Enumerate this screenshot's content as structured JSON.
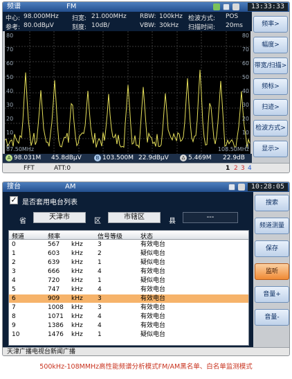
{
  "analyzer": {
    "title": "频谱",
    "mode": "FM",
    "time": "13:33:33",
    "info": {
      "center_label": "中心:",
      "center_value": "98.000MHz",
      "span_label": "扫宽:",
      "span_value": "21.000MHz",
      "rbw_label": "RBW:",
      "rbw_value": "100kHz",
      "detector_label": "检波方式:",
      "detector_value": "POS",
      "ref_label": "参考:",
      "ref_value": "80.0dBμV",
      "scale_label": "刻度:",
      "scale_value": "10dB/",
      "vbw_label": "VBW:",
      "vbw_value": "30kHz",
      "sweep_label": "扫描时间:",
      "sweep_value": "20ms"
    },
    "level_labels": [
      "80",
      "70",
      "60",
      "50",
      "40",
      "30",
      "20",
      "10",
      "0"
    ],
    "freq_start": "87.50MHz",
    "freq_stop": "108.50MHz",
    "markers": [
      {
        "id": "A",
        "freq": "98.031M",
        "level": "45.8dBμV"
      },
      {
        "id": "B",
        "freq": "103.500M",
        "level": "22.9dBμV"
      },
      {
        "id": "Δ",
        "freq": "5.469M",
        "level": "22.9dB"
      }
    ],
    "status": {
      "fft": "FFT",
      "att": "ATT:0",
      "pages": [
        "1",
        "2",
        "3",
        "4"
      ]
    },
    "softkeys": [
      "频率>",
      "幅度>",
      "带宽/扫描>",
      "频标>",
      "扫迹>",
      "检波方式>",
      "显示>"
    ],
    "colors": {
      "trace": "#e6e05a",
      "marker_a": "#bfe08a",
      "marker_b": "#a9c8ea",
      "active": "#f08a35"
    }
  },
  "receiver": {
    "title": "搜台",
    "mode": "AM",
    "time": "10:28:05",
    "use_station_list": {
      "label": "是否套用电台列表",
      "checked": "✓"
    },
    "location": {
      "province_label": "省",
      "province_value": "天津市",
      "district_label": "区",
      "district_value": "市辖区",
      "county_label": "县",
      "county_value": "---"
    },
    "columns": [
      "频道",
      "频率",
      "信号等级",
      "状态"
    ],
    "rows": [
      {
        "ch": "0",
        "freq": "567",
        "unit": "kHz",
        "level": "3",
        "status": "有效电台"
      },
      {
        "ch": "1",
        "freq": "603",
        "unit": "kHz",
        "level": "2",
        "status": "疑似电台"
      },
      {
        "ch": "2",
        "freq": "639",
        "unit": "kHz",
        "level": "1",
        "status": "疑似电台"
      },
      {
        "ch": "3",
        "freq": "666",
        "unit": "kHz",
        "level": "4",
        "status": "有效电台"
      },
      {
        "ch": "4",
        "freq": "720",
        "unit": "kHz",
        "level": "1",
        "status": "疑似电台"
      },
      {
        "ch": "5",
        "freq": "747",
        "unit": "kHz",
        "level": "4",
        "status": "有效电台"
      },
      {
        "ch": "6",
        "freq": "909",
        "unit": "kHz",
        "level": "3",
        "status": "有效电台"
      },
      {
        "ch": "7",
        "freq": "1008",
        "unit": "kHz",
        "level": "3",
        "status": "有效电台"
      },
      {
        "ch": "8",
        "freq": "1071",
        "unit": "kHz",
        "level": "4",
        "status": "有效电台"
      },
      {
        "ch": "9",
        "freq": "1386",
        "unit": "kHz",
        "level": "4",
        "status": "有效电台"
      },
      {
        "ch": "10",
        "freq": "1476",
        "unit": "kHz",
        "level": "1",
        "status": "疑似电台"
      }
    ],
    "selected_row": "6",
    "footer": "天津广播电视台新闻广播",
    "softkeys": [
      "搜索",
      "频道测量",
      "保存",
      "监听",
      "音量+",
      "音量-"
    ],
    "active_softkey": "监听"
  },
  "caption": "500kHz-108MMHz高性能频谱分析模式FM/AM黑名单、白名单监测模式"
}
